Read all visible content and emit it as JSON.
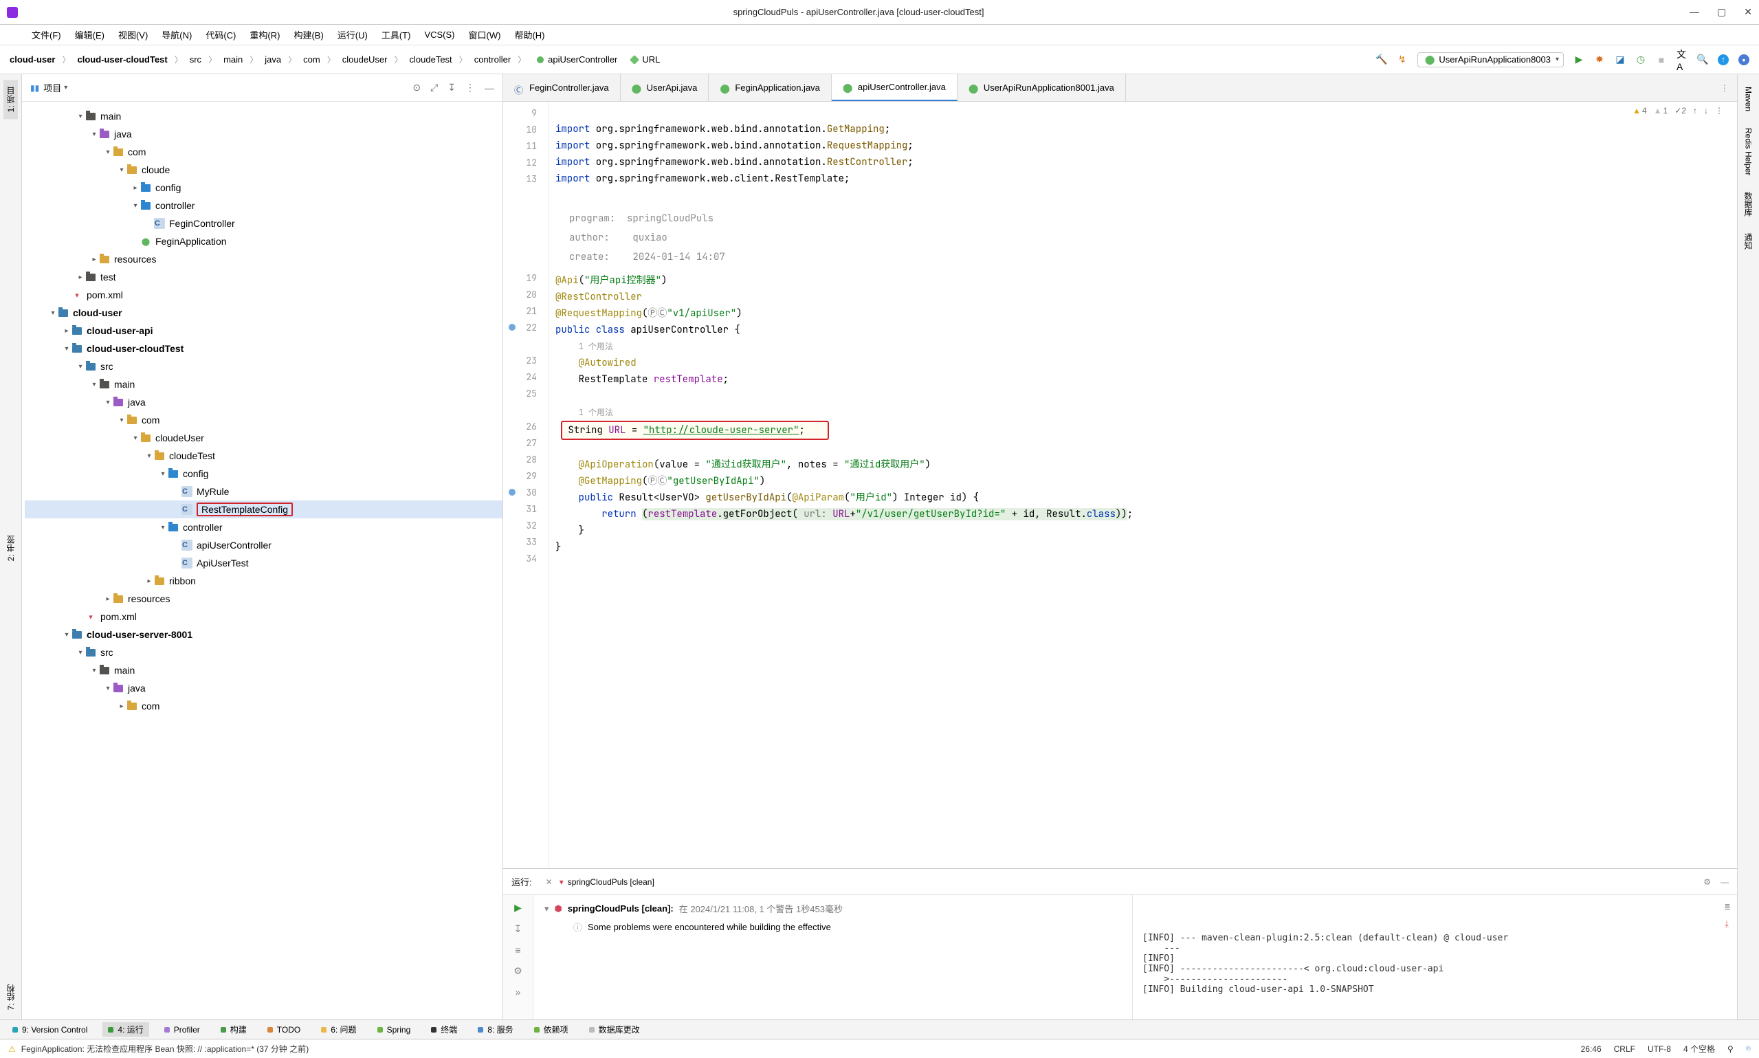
{
  "window": {
    "title": "springCloudPuls - apiUserController.java [cloud-user-cloudTest]"
  },
  "menus": [
    "文件(F)",
    "编辑(E)",
    "视图(V)",
    "导航(N)",
    "代码(C)",
    "重构(R)",
    "构建(B)",
    "运行(U)",
    "工具(T)",
    "VCS(S)",
    "窗口(W)",
    "帮助(H)"
  ],
  "breadcrumb": {
    "crumbs": [
      "cloud-user",
      "cloud-user-cloudTest",
      "src",
      "main",
      "java",
      "com",
      "cloudeUser",
      "cloudeTest",
      "controller"
    ],
    "file": "apiUserController",
    "url_label": "URL"
  },
  "runConfig": {
    "selected": "UserApiRunApplication8003"
  },
  "leftRail": {
    "tabs": [
      "1: 项目"
    ]
  },
  "rightRail": {
    "tabs": [
      "Maven",
      "Redis Helper",
      "数据库",
      "通知"
    ]
  },
  "project": {
    "header": "项目",
    "tree": [
      {
        "d": 3,
        "tw": "v",
        "ic": "folder",
        "name": "main"
      },
      {
        "d": 4,
        "tw": "v",
        "ic": "purple",
        "name": "java"
      },
      {
        "d": 5,
        "tw": "v",
        "ic": "pkg",
        "name": "com"
      },
      {
        "d": 6,
        "tw": "v",
        "ic": "pkg",
        "name": "cloude"
      },
      {
        "d": 7,
        "tw": ">",
        "ic": "blue",
        "name": "config"
      },
      {
        "d": 7,
        "tw": "v",
        "ic": "blue",
        "name": "controller"
      },
      {
        "d": 8,
        "tw": "",
        "ic": "class",
        "name": "FeginController"
      },
      {
        "d": 7,
        "tw": "",
        "ic": "app",
        "name": "FeginApplication"
      },
      {
        "d": 4,
        "tw": ">",
        "ic": "pkg",
        "name": "resources"
      },
      {
        "d": 3,
        "tw": ">",
        "ic": "folder",
        "name": "test"
      },
      {
        "d": 2,
        "tw": "",
        "ic": "xml",
        "name": "pom.xml"
      },
      {
        "d": 1,
        "tw": "v",
        "ic": "mod",
        "name": "cloud-user",
        "bold": true
      },
      {
        "d": 2,
        "tw": ">",
        "ic": "mod",
        "name": "cloud-user-api",
        "bold": true
      },
      {
        "d": 2,
        "tw": "v",
        "ic": "mod",
        "name": "cloud-user-cloudTest",
        "bold": true
      },
      {
        "d": 3,
        "tw": "v",
        "ic": "mod",
        "name": "src"
      },
      {
        "d": 4,
        "tw": "v",
        "ic": "folder",
        "name": "main"
      },
      {
        "d": 5,
        "tw": "v",
        "ic": "purple",
        "name": "java"
      },
      {
        "d": 6,
        "tw": "v",
        "ic": "pkg",
        "name": "com"
      },
      {
        "d": 7,
        "tw": "v",
        "ic": "pkg",
        "name": "cloudeUser"
      },
      {
        "d": 8,
        "tw": "v",
        "ic": "pkg",
        "name": "cloudeTest"
      },
      {
        "d": 9,
        "tw": "v",
        "ic": "blue",
        "name": "config"
      },
      {
        "d": 10,
        "tw": "",
        "ic": "class",
        "name": "MyRule"
      },
      {
        "d": 10,
        "tw": "",
        "ic": "class",
        "name": "RestTemplateConfig",
        "sel": true,
        "box": true
      },
      {
        "d": 9,
        "tw": "v",
        "ic": "blue",
        "name": "controller"
      },
      {
        "d": 10,
        "tw": "",
        "ic": "class",
        "name": "apiUserController"
      },
      {
        "d": 10,
        "tw": "",
        "ic": "class",
        "name": "ApiUserTest"
      },
      {
        "d": 8,
        "tw": ">",
        "ic": "pkg",
        "name": "ribbon"
      },
      {
        "d": 5,
        "tw": ">",
        "ic": "pkg",
        "name": "resources"
      },
      {
        "d": 3,
        "tw": "",
        "ic": "xml",
        "name": "pom.xml"
      },
      {
        "d": 2,
        "tw": "v",
        "ic": "mod",
        "name": "cloud-user-server-8001",
        "bold": true
      },
      {
        "d": 3,
        "tw": "v",
        "ic": "mod",
        "name": "src"
      },
      {
        "d": 4,
        "tw": "v",
        "ic": "folder",
        "name": "main"
      },
      {
        "d": 5,
        "tw": "v",
        "ic": "purple",
        "name": "java"
      },
      {
        "d": 6,
        "tw": ">",
        "ic": "pkg",
        "name": "com"
      }
    ]
  },
  "editorTabs": [
    {
      "label": "FeginController.java",
      "ic": "class"
    },
    {
      "label": "UserApi.java",
      "ic": "app"
    },
    {
      "label": "FeginApplication.java",
      "ic": "app"
    },
    {
      "label": "apiUserController.java",
      "ic": "app",
      "active": true
    },
    {
      "label": "UserApiRunApplication8001.java",
      "ic": "app"
    }
  ],
  "inspections": {
    "warn_y": "4",
    "warn_g": "1",
    "typo": "2"
  },
  "docbox": {
    "program_k": "program:",
    "program_v": "springCloudPuls",
    "author_k": "author:",
    "author_v": "quxiao",
    "create_k": "create:",
    "create_v": "2024-01-14 14:07"
  },
  "code": {
    "lines": {
      "9": "import org.springframework.web.bind.annotation.GetMapping;",
      "10": "import org.springframework.web.bind.annotation.RequestMapping;",
      "11": "import org.springframework.web.bind.annotation.RestController;",
      "12": "import org.springframework.web.client.RestTemplate;",
      "19": "@Api(\"用户api控制器\")",
      "20": "@RestController",
      "21": "@RequestMapping(ⓅⒸ\"v1/apiUser\")",
      "22": "public class apiUserController {",
      "22h": "1 个用法",
      "23": "@Autowired",
      "24": "RestTemplate restTemplate;",
      "26h": "1 个用法",
      "26a": "String ",
      "26b": "URL",
      "26c": " = ",
      "26d": "\"http://cloude-user-server\"",
      "26e": ";",
      "28": "@ApiOperation(value = \"通过id获取用户\", notes = \"通过id获取用户\")",
      "29": "@GetMapping(ⓅⒸ\"getUserByIdApi\")",
      "30": "public Result<UserVO> getUserByIdApi(@ApiParam(\"用户id\") Integer id) {",
      "31a": "    return ",
      "31b": "(restTemplate.getForObject( url: URL+\"/v1/user/getUserById?id=\" + id, Result.class));",
      "32": "}",
      "33": "}"
    },
    "gutter": [
      "9",
      "10",
      "11",
      "12",
      "13",
      "",
      "",
      "",
      "",
      "",
      "19",
      "20",
      "21",
      "22",
      "",
      "23",
      "24",
      "25",
      "",
      "26",
      "27",
      "28",
      "29",
      "30",
      "31",
      "32",
      "33",
      "34"
    ]
  },
  "runPanel": {
    "head_label": "运行:",
    "config": "springCloudPuls [clean]",
    "msg_title": "springCloudPuls [clean]:",
    "msg_time": "在 2024/1/21 11:08,  1 个警告 1秒453毫秒",
    "msg_body": "Some problems were encountered while building the effective",
    "console": [
      "[INFO] --- maven-clean-plugin:2.5:clean (default-clean) @ cloud-user",
      "    ---",
      "[INFO]",
      "[INFO] -----------------------< org.cloud:cloud-user-api",
      "    >----------------------",
      "[INFO] Building cloud-user-api 1.0-SNAPSHOT"
    ]
  },
  "toolTabs": [
    {
      "label": "9: Version Control",
      "dot": "#2aa3b5"
    },
    {
      "label": "4: 运行",
      "dot": "#3a9a3a",
      "active": true
    },
    {
      "label": "Profiler",
      "dot": "#a679d6"
    },
    {
      "label": "构建",
      "dot": "#4a9a4a"
    },
    {
      "label": "TODO",
      "dot": "#d9853b"
    },
    {
      "label": "6: 问题",
      "dot": "#e9b949"
    },
    {
      "label": "Spring",
      "dot": "#6db33f"
    },
    {
      "label": "终端",
      "dot": "#333"
    },
    {
      "label": "8: 服务",
      "dot": "#4b8bcc"
    },
    {
      "label": "依赖项",
      "dot": "#6db33f"
    },
    {
      "label": "数据库更改",
      "dot": "#bbb"
    }
  ],
  "status": {
    "msg": "FeginApplication: 无法检查应用程序 Bean 快照: // :application=* (37 分钟 之前)",
    "pos": "26:46",
    "eol": "CRLF",
    "enc": "UTF-8",
    "indent": "4 个空格"
  }
}
